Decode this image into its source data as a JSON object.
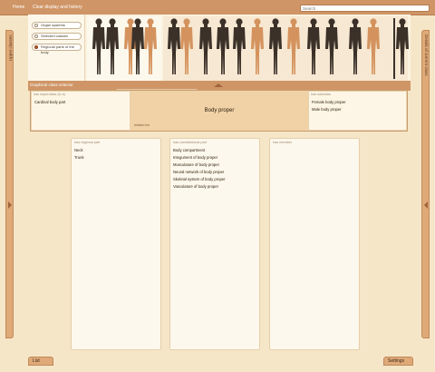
{
  "topbar": {
    "home": "Home",
    "clear": "Clear display and history",
    "search_placeholder": "Search"
  },
  "sidetabs": {
    "left": "Upper classes",
    "right": "Details of current class"
  },
  "picker": {
    "radios": [
      {
        "label": "Organ systems",
        "selected": false
      },
      {
        "label": "Selected classes",
        "selected": false
      },
      {
        "label": "Regional parts of the body",
        "selected": true
      }
    ],
    "figure_count": 11
  },
  "graphical_selector": {
    "label": "Graphical class selector"
  },
  "class_selector": {
    "superclass_header": "has superclass (is a)",
    "superclass_items": [
      "Cardinal body part"
    ],
    "current": "Body proper",
    "current_sub": "relation list",
    "subclass_header": "has subclass",
    "subclass_items": [
      "Female body proper",
      "Male body proper"
    ]
  },
  "panels": [
    {
      "header": "has regional part",
      "items": [
        "Neck",
        "Trunk"
      ]
    },
    {
      "header": "has constitutional part",
      "items": [
        "Body compartment",
        "Integument of body proper",
        "Musculature of body proper",
        "Neural network of body proper",
        "Skeletal system of body proper",
        "Vasculature of body proper"
      ]
    },
    {
      "header": "has member",
      "items": []
    }
  ],
  "bottom": {
    "list": "List",
    "settings": "Settings"
  },
  "colors": {
    "bar": "#cf9566",
    "figure_dark": "#3b3129",
    "figure_highlight": "#d4935e",
    "background": "#f6e6c8"
  }
}
